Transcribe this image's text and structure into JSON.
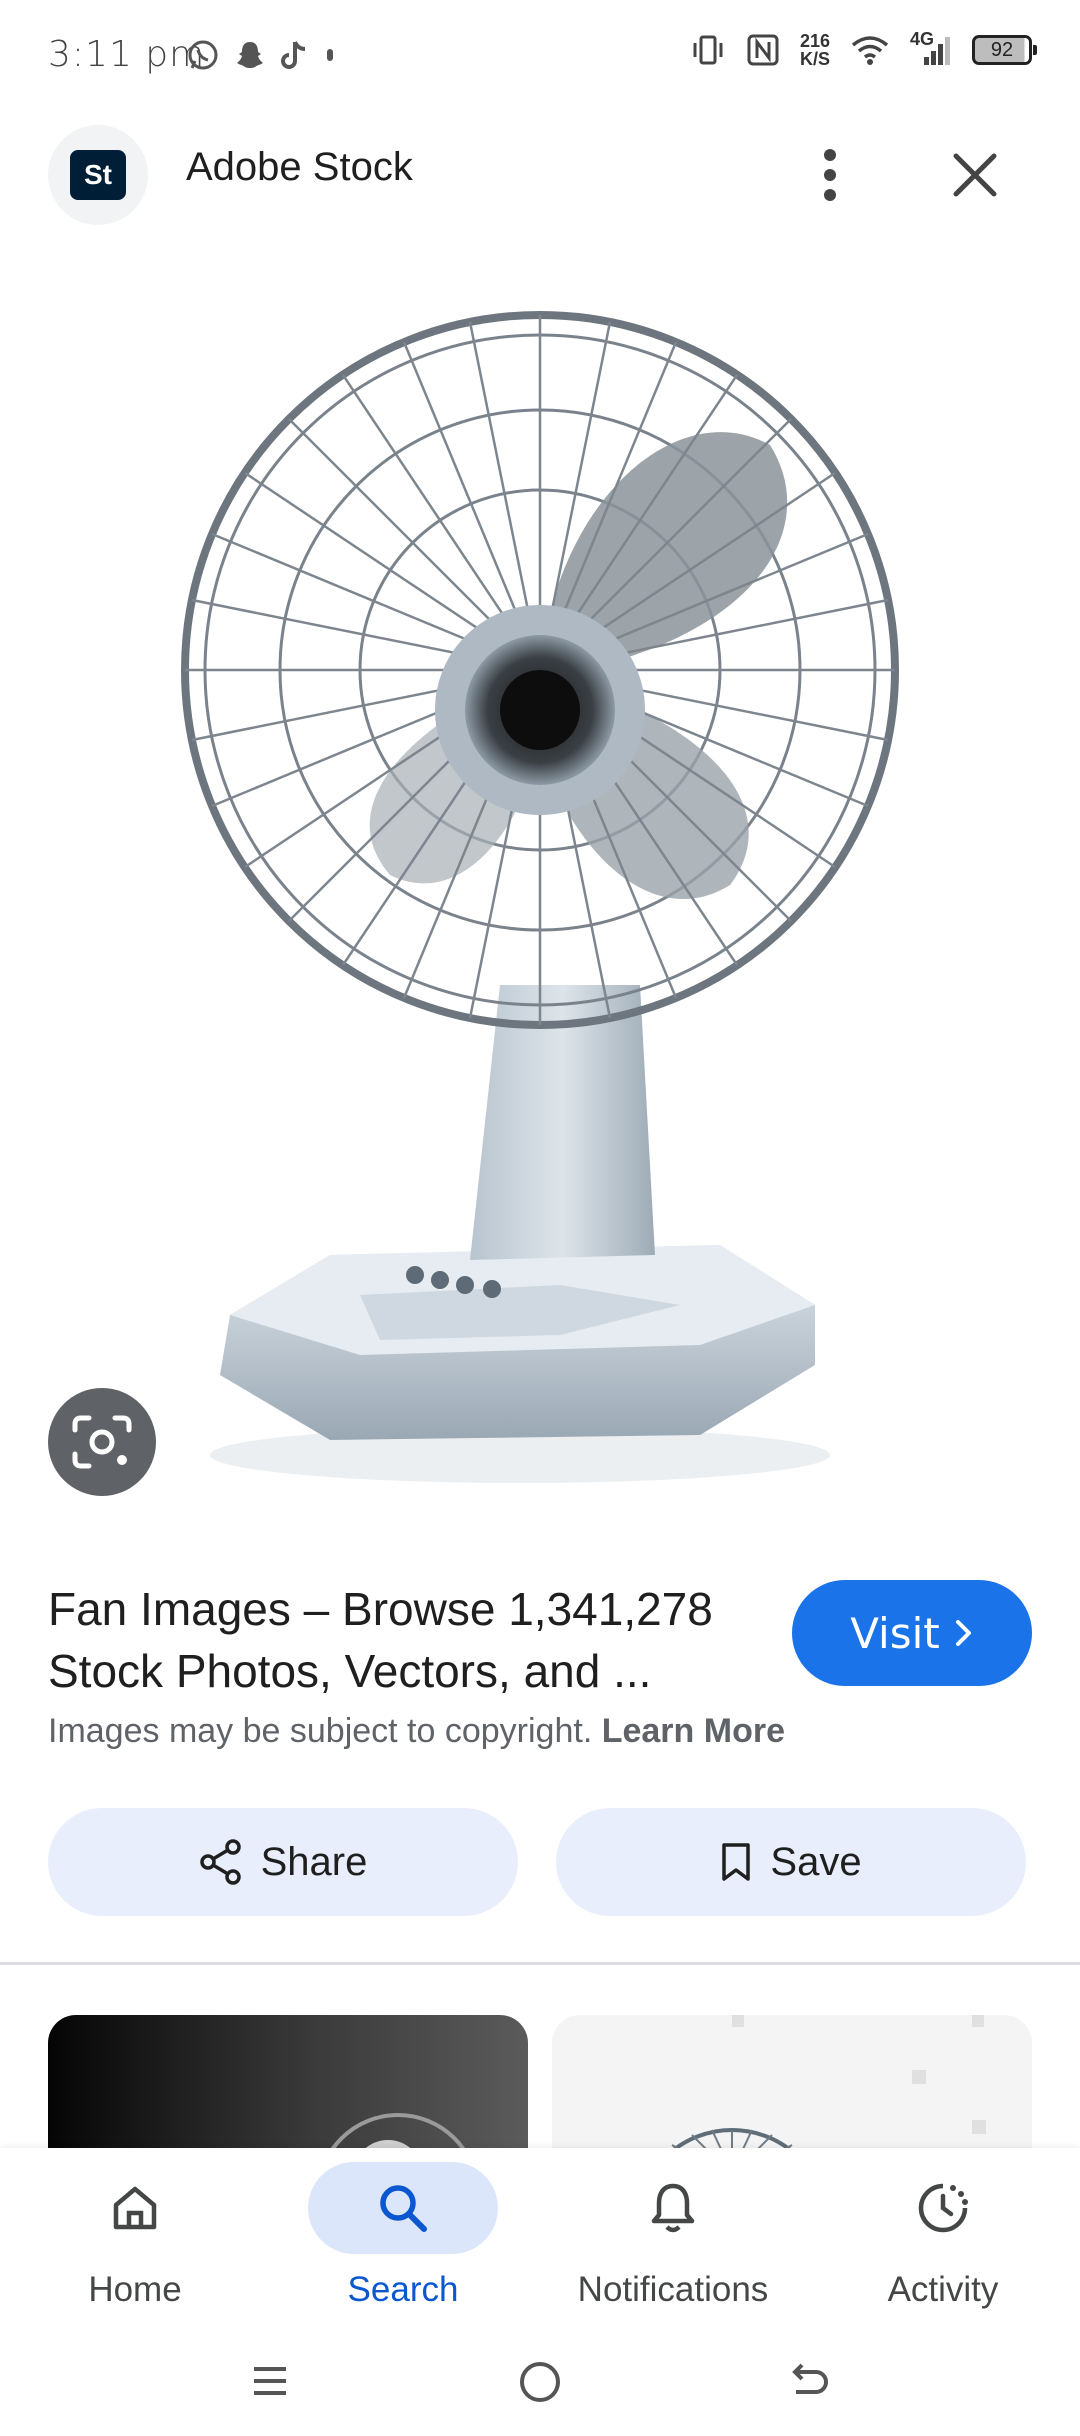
{
  "status_bar": {
    "time": "3:11 pm",
    "net_speed_value": "216",
    "net_speed_unit": "K/S",
    "network_type": "4G",
    "battery": "92"
  },
  "header": {
    "site_logo_text": "St",
    "site_name": "Adobe Stock"
  },
  "result": {
    "title_line1": "Fan Images – Browse 1,341,278",
    "title_line2": "Stock Photos, Vectors, and ...",
    "visit_label": "Visit",
    "copyright_text": "Images may be subject to copyright.",
    "learn_more_label": "Learn More",
    "share_label": "Share",
    "save_label": "Save"
  },
  "bottom_nav": {
    "items": [
      {
        "label": "Home",
        "icon": "home-icon",
        "active": false
      },
      {
        "label": "Search",
        "icon": "search-icon",
        "active": true
      },
      {
        "label": "Notifications",
        "icon": "bell-icon",
        "active": false
      },
      {
        "label": "Activity",
        "icon": "activity-icon",
        "active": false
      }
    ]
  },
  "colors": {
    "accent": "#1a73e8",
    "active_nav": "#0b57d0",
    "chip_bg": "#e8eefb"
  }
}
